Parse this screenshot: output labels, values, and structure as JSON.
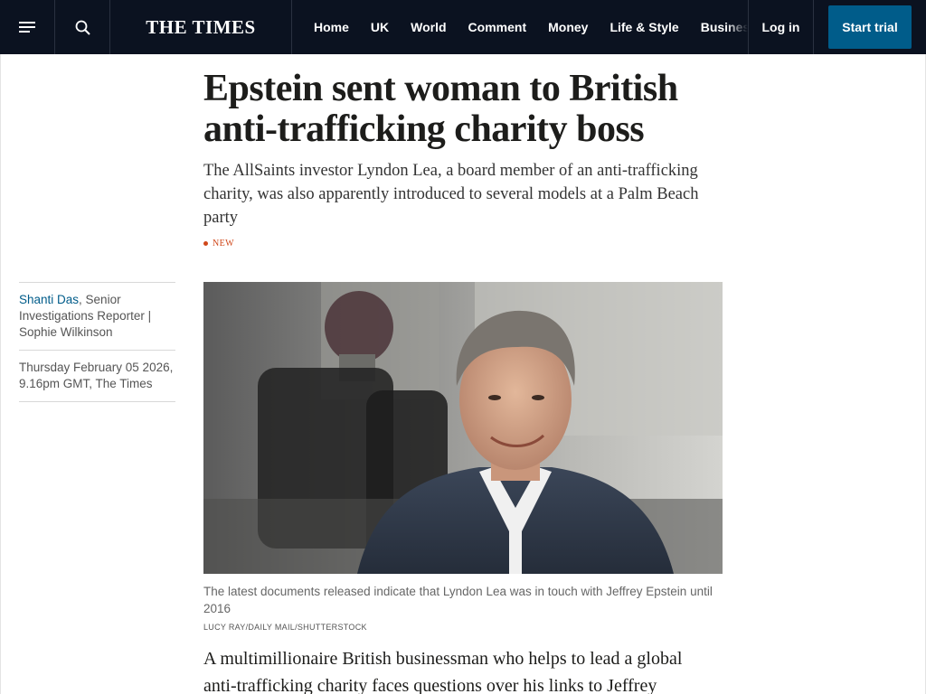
{
  "nav": {
    "logo_text": "THE TIMES",
    "menu_icon": "hamburger-menu-icon",
    "search_icon": "search-icon",
    "links": [
      "Home",
      "UK",
      "World",
      "Comment",
      "Money",
      "Life & Style",
      "Business"
    ],
    "login_label": "Log in",
    "trial_label": "Start trial"
  },
  "article": {
    "headline": "Epstein sent woman to British anti-trafficking charity boss",
    "standfirst": "The AllSaints investor Lyndon Lea, a board member of an anti-trafficking charity, was also apparently introduced to several models at a Palm Beach party",
    "badge": "NEW",
    "byline": {
      "author": "Shanti Das",
      "author_rest": ", Senior Investigations Reporter | Sophie Wilkinson",
      "dateline": "Thursday February 05 2026, 9.16pm GMT, The Times"
    },
    "image_caption": "The latest documents released indicate that Lyndon Lea was in touch with Jeffrey Epstein until 2016",
    "image_credit": "LUCY RAY/DAILY MAIL/SHUTTERSTOCK",
    "body_opening": "A multimillionaire British businessman who helps to lead a global anti-trafficking charity faces questions over his links to Jeffrey"
  },
  "colors": {
    "nav_bg": "#0b1220",
    "accent": "#005c8a",
    "badge": "#d0481b"
  }
}
